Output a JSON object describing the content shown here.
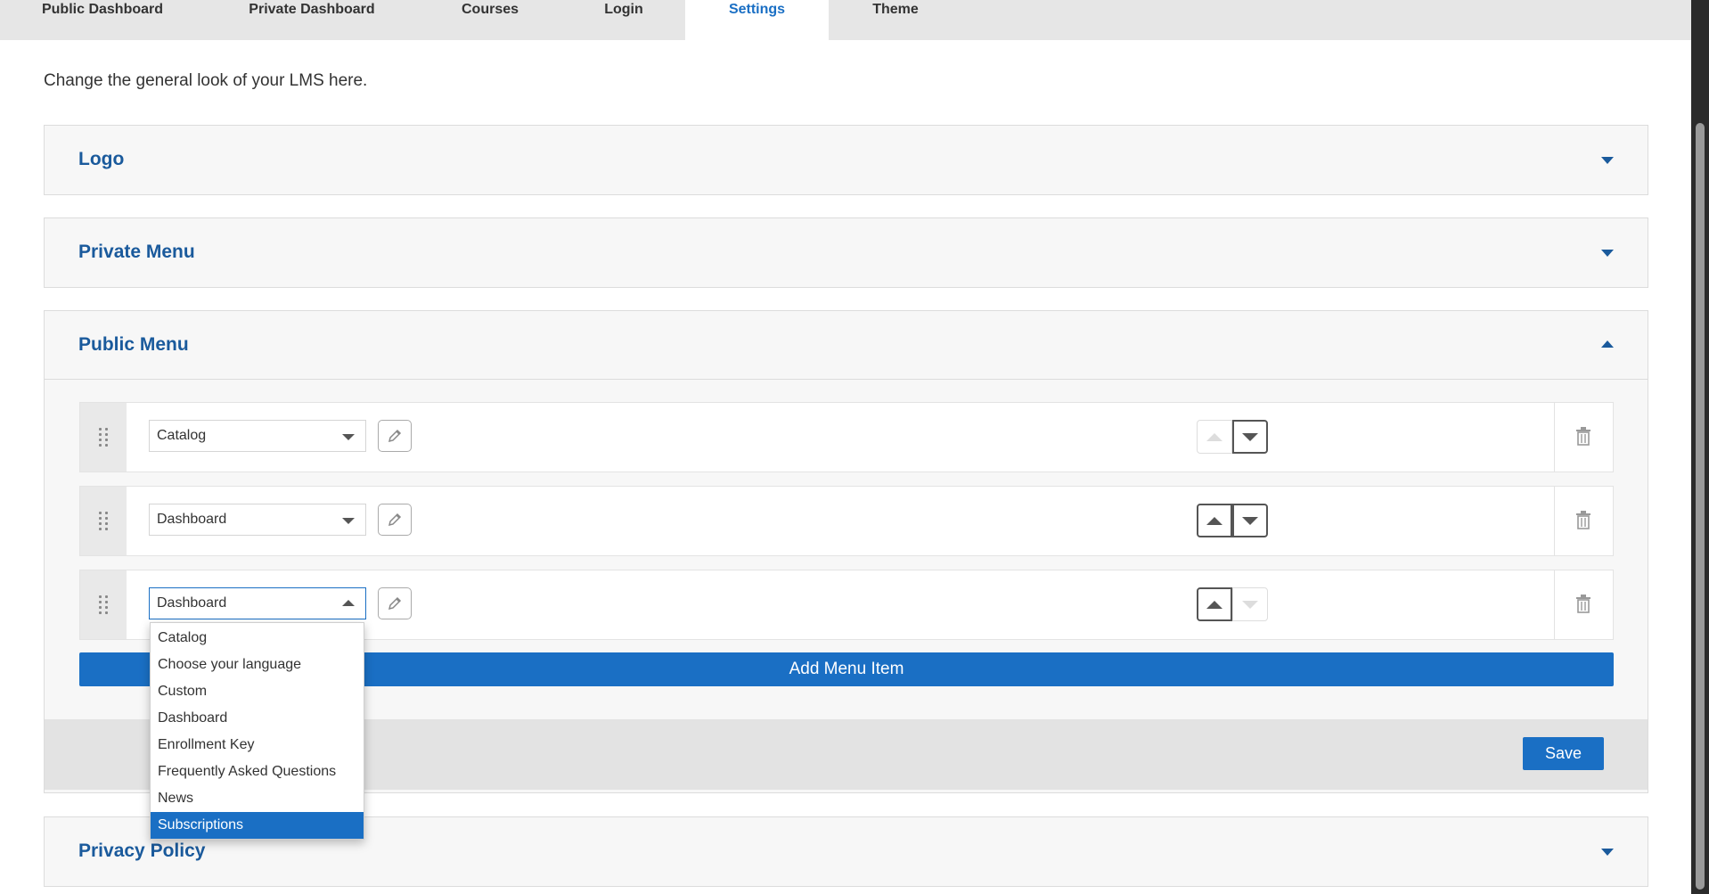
{
  "tabs": [
    {
      "label": "Public Dashboard",
      "active": false
    },
    {
      "label": "Private Dashboard",
      "active": false
    },
    {
      "label": "Courses",
      "active": false
    },
    {
      "label": "Login",
      "active": false
    },
    {
      "label": "Settings",
      "active": true
    },
    {
      "label": "Theme",
      "active": false
    }
  ],
  "intro": "Change the general look of your LMS here.",
  "panels": {
    "logo": {
      "title": "Logo"
    },
    "private_menu": {
      "title": "Private Menu"
    },
    "public_menu": {
      "title": "Public Menu"
    },
    "privacy_policy": {
      "title": "Privacy Policy"
    }
  },
  "menu_items": [
    {
      "value": "Catalog",
      "up_enabled": false,
      "down_enabled": true
    },
    {
      "value": "Dashboard",
      "up_enabled": true,
      "down_enabled": true
    },
    {
      "value": "Dashboard",
      "up_enabled": true,
      "down_enabled": false
    }
  ],
  "add_menu_item_label": "Add Menu Item",
  "save_label": "Save",
  "dropdown_options": [
    "Catalog",
    "Choose your language",
    "Custom",
    "Dashboard",
    "Enrollment Key",
    "Frequently Asked Questions",
    "News",
    "Subscriptions"
  ],
  "dropdown_highlighted": "Subscriptions",
  "colors": {
    "accent": "#1a6fc4",
    "title": "#1a5a9c"
  }
}
